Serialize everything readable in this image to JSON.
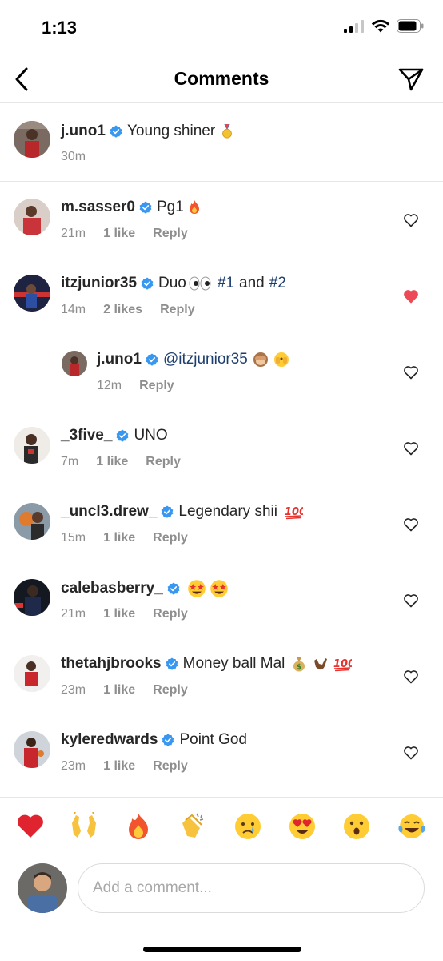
{
  "status_bar": {
    "time": "1:13",
    "icons": [
      "cellular-signal-icon",
      "wifi-icon",
      "battery-icon"
    ]
  },
  "nav": {
    "title": "Comments",
    "back_icon": "chevron-left-icon",
    "share_icon": "paper-plane-icon"
  },
  "caption": {
    "username": "j.uno1",
    "text": "Young shiner",
    "emoji": "medal",
    "time": "30m"
  },
  "comments": [
    {
      "username": "m.sasser0",
      "text": "Pg1",
      "emoji": [
        "fire"
      ],
      "time": "21m",
      "likes": "1 like",
      "reply": "Reply",
      "liked": false
    },
    {
      "username": "itzjunior35",
      "text": "Duo",
      "emoji": [
        "eyes"
      ],
      "tags": [
        "#1",
        "#2"
      ],
      "tag_joiner": "and",
      "time": "14m",
      "likes": "2 likes",
      "reply": "Reply",
      "liked": true
    },
    {
      "username": "j.uno1",
      "mention": "@itzjunior35",
      "emoji": [
        "see-no-evil-monkey",
        "face-peeking"
      ],
      "time": "12m",
      "reply": "Reply",
      "liked": false,
      "is_reply": true
    },
    {
      "username": "_3five_",
      "text": "UNO",
      "time": "7m",
      "likes": "1 like",
      "reply": "Reply",
      "liked": false
    },
    {
      "username": "_uncl3.drew_",
      "text": "Legendary shii",
      "emoji": [
        "hundred"
      ],
      "time": "15m",
      "likes": "1 like",
      "reply": "Reply",
      "liked": false
    },
    {
      "username": "calebasberry_",
      "emoji": [
        "star-struck",
        "star-struck"
      ],
      "time": "21m",
      "likes": "1 like",
      "reply": "Reply",
      "liked": false
    },
    {
      "username": "thetahjbrooks",
      "text": "Money ball Mal",
      "emoji": [
        "money-bag",
        "call-me-hand",
        "hundred"
      ],
      "time": "23m",
      "likes": "1 like",
      "reply": "Reply",
      "liked": false
    },
    {
      "username": "kyleredwards",
      "text": "Point God",
      "time": "23m",
      "likes": "1 like",
      "reply": "Reply",
      "liked": false
    }
  ],
  "reactions": [
    "red-heart",
    "raising-hands",
    "fire",
    "clapping-hands",
    "crying-face",
    "heart-eyes",
    "surprised-face",
    "tears-of-joy"
  ],
  "input": {
    "placeholder": "Add a comment..."
  },
  "colors": {
    "verified": "#3897f0",
    "liked_heart": "#ed4956",
    "meta_text": "#8e8e8e",
    "mention": "#1c3e6e"
  }
}
